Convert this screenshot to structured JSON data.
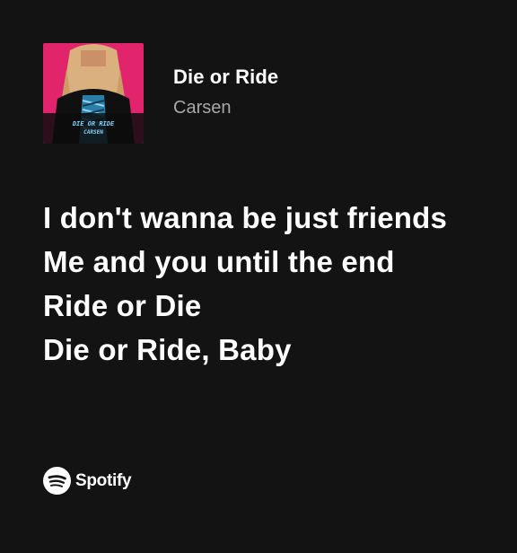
{
  "track": {
    "title": "Die or Ride",
    "artist": "Carsen",
    "cover_text_line1": "DIE OR RIDE",
    "cover_text_line2": "CARSEN",
    "cover_colors": {
      "background": "#e1246b",
      "hair": "#d9b07e",
      "jacket": "#101010",
      "shirt": "#2a7ea7",
      "text": "#7fd0ff"
    }
  },
  "lyrics": [
    "I don't wanna be just friends",
    "Me and you until the end",
    "Ride or Die",
    "Die or Ride, Baby"
  ],
  "brand": {
    "name": "Spotify",
    "logo_icon": "spotify-logo-icon",
    "color": "#ffffff"
  },
  "theme": {
    "background": "#131313",
    "text_primary": "#ffffff",
    "text_secondary": "#a7a7a7"
  }
}
